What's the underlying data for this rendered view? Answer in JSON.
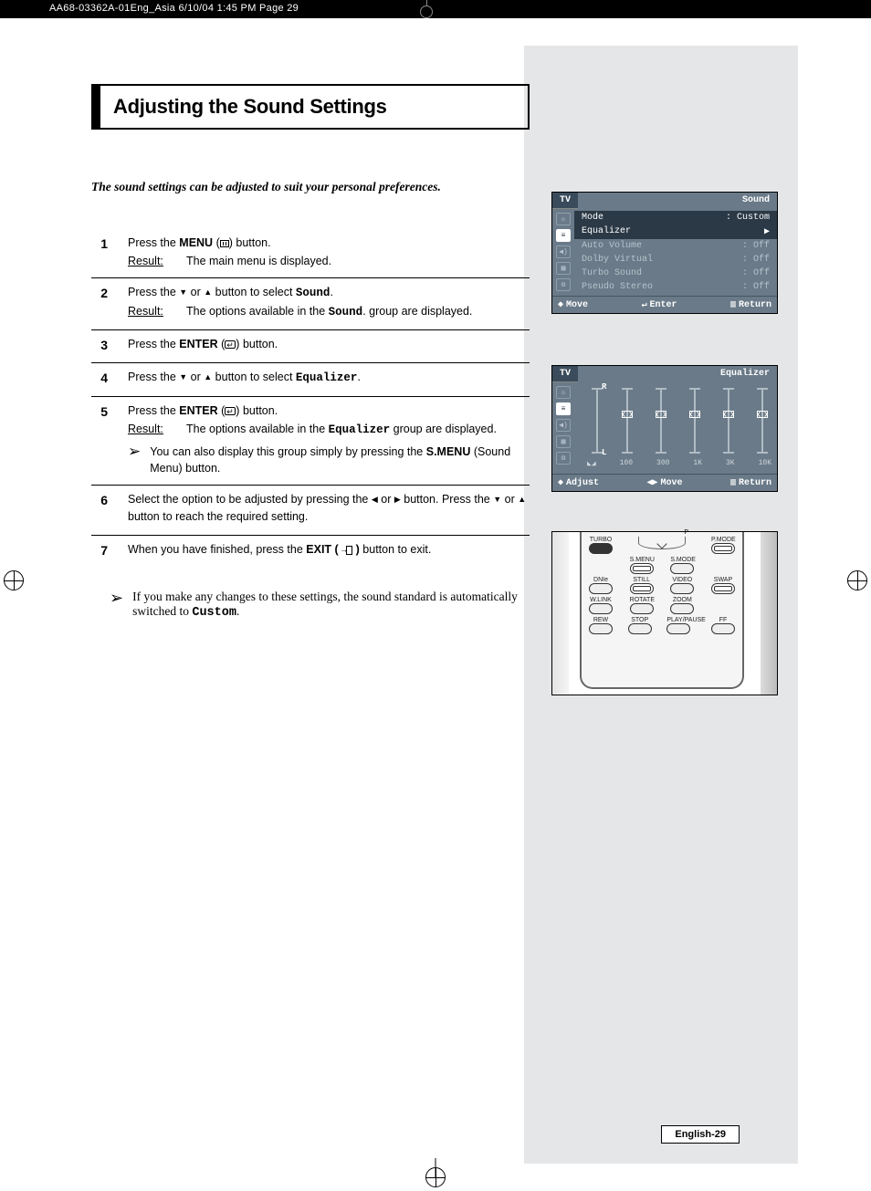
{
  "header_strip": "AA68-03362A-01Eng_Asia  6/10/04  1:45 PM  Page 29",
  "title": "Adjusting the Sound Settings",
  "intro": "The sound settings can be adjusted to suit your personal preferences.",
  "steps": {
    "s1": {
      "num": "1",
      "line1a": "Press the ",
      "line1b": "MENU",
      "line1c": " button.",
      "result_label": "Result:",
      "result_text": "The main menu is displayed."
    },
    "s2": {
      "num": "2",
      "line_a": "Press the ",
      "line_b": " or ",
      "line_c": " button to select ",
      "target": "Sound",
      "line_d": ".",
      "result_label": "Result:",
      "result_pre": "The options available in the ",
      "result_bold": "Sound",
      "result_post": ". group are displayed."
    },
    "s3": {
      "num": "3",
      "line_a": "Press the ",
      "line_b": "ENTER",
      "line_c": " button."
    },
    "s4": {
      "num": "4",
      "line_a": "Press the ",
      "line_b": " or ",
      "line_c": " button to select ",
      "target": "Equalizer",
      "line_d": "."
    },
    "s5": {
      "num": "5",
      "line_a": "Press the ",
      "line_b": "ENTER",
      "line_c": " button.",
      "result_label": "Result:",
      "result_pre": "The options available in the ",
      "result_bold": "Equalizer",
      "result_post": " group are displayed.",
      "note_a": "You can also display this group simply by pressing the ",
      "note_bold": "S.MENU",
      "note_b": " (Sound Menu) button."
    },
    "s6": {
      "num": "6",
      "line_a": "Select the option to be adjusted by pressing the ",
      "line_mid": " or ",
      "line_b": " button. Press the ",
      "line_mid2": " or ",
      "line_c": " button to reach the required setting."
    },
    "s7": {
      "num": "7",
      "line_a": "When you have finished, press the ",
      "line_bold": "EXIT ( ",
      "line_b": " )",
      "line_c": " button to exit."
    }
  },
  "footnote": {
    "text_a": "If you make any changes to these settings, the sound standard is automatically switched to ",
    "bold": "Custom",
    "text_b": "."
  },
  "osd1": {
    "tab": "TV",
    "title": "Sound",
    "rows": [
      {
        "label": "Mode",
        "value": ": Custom",
        "sel": true
      },
      {
        "label": "Equalizer",
        "value": "▶",
        "sel": true
      },
      {
        "label": "Auto Volume",
        "value": ": Off"
      },
      {
        "label": "Dolby Virtual",
        "value": ": Off"
      },
      {
        "label": "Turbo Sound",
        "value": ": Off"
      },
      {
        "label": "Pseudo Stereo",
        "value": ": Off"
      }
    ],
    "footer": {
      "move": "Move",
      "enter": "Enter",
      "return": "Return"
    }
  },
  "osd2": {
    "tab": "TV",
    "title": "Equalizer",
    "balance_top": "R",
    "balance_bot": "L",
    "freqs": [
      "100",
      "300",
      "1K",
      "3K",
      "10K"
    ],
    "floor_icon": "◣◢",
    "footer": {
      "adjust": "Adjust",
      "move": "Move",
      "return": "Return"
    }
  },
  "remote": {
    "row1": [
      "TURBO",
      "",
      "P.MODE"
    ],
    "over_arc_left": "",
    "over_arc_right": "P",
    "row2": [
      "",
      "S.MENU",
      "S.MODE",
      ""
    ],
    "row3": [
      "DNIe",
      "STILL",
      "VIDEO",
      "SWAP"
    ],
    "row4": [
      "W.LINK",
      "ROTATE",
      "ZOOM",
      ""
    ],
    "row5": [
      "REW",
      "STOP",
      "PLAY/PAUSE",
      "FF"
    ]
  },
  "page_number": "English-29"
}
